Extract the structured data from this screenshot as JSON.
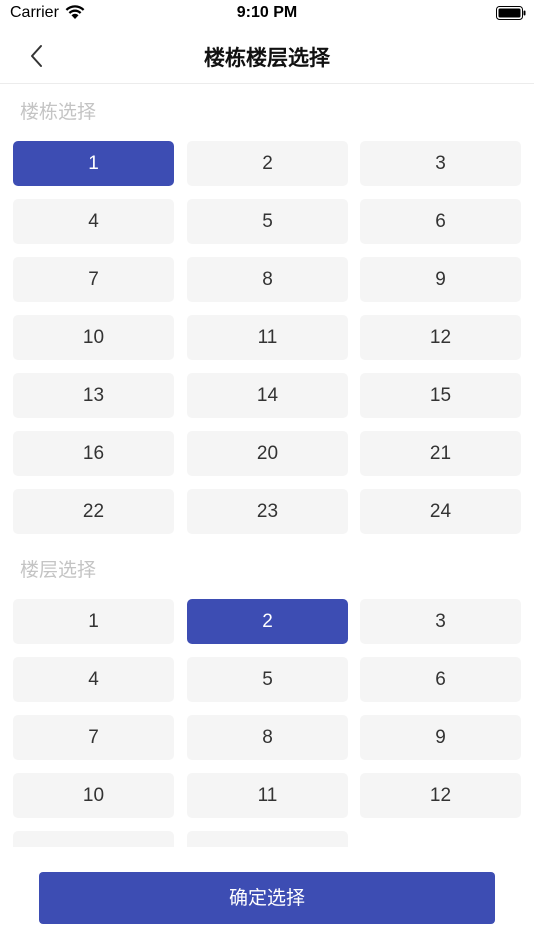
{
  "status_bar": {
    "carrier": "Carrier",
    "time": "9:10 PM"
  },
  "nav": {
    "title": "楼栋楼层选择"
  },
  "building_section": {
    "label": "楼栋选择",
    "selected": "1",
    "items": [
      "1",
      "2",
      "3",
      "4",
      "5",
      "6",
      "7",
      "8",
      "9",
      "10",
      "11",
      "12",
      "13",
      "14",
      "15",
      "16",
      "20",
      "21",
      "22",
      "23",
      "24"
    ]
  },
  "floor_section": {
    "label": "楼层选择",
    "selected": "2",
    "items": [
      "1",
      "2",
      "3",
      "4",
      "5",
      "6",
      "7",
      "8",
      "9",
      "10",
      "11",
      "12",
      "",
      ""
    ]
  },
  "confirm_button": {
    "label": "确定选择"
  },
  "colors": {
    "accent": "#3d4db3",
    "cell_bg": "#f5f5f5",
    "label_gray": "#c4c4c4"
  }
}
